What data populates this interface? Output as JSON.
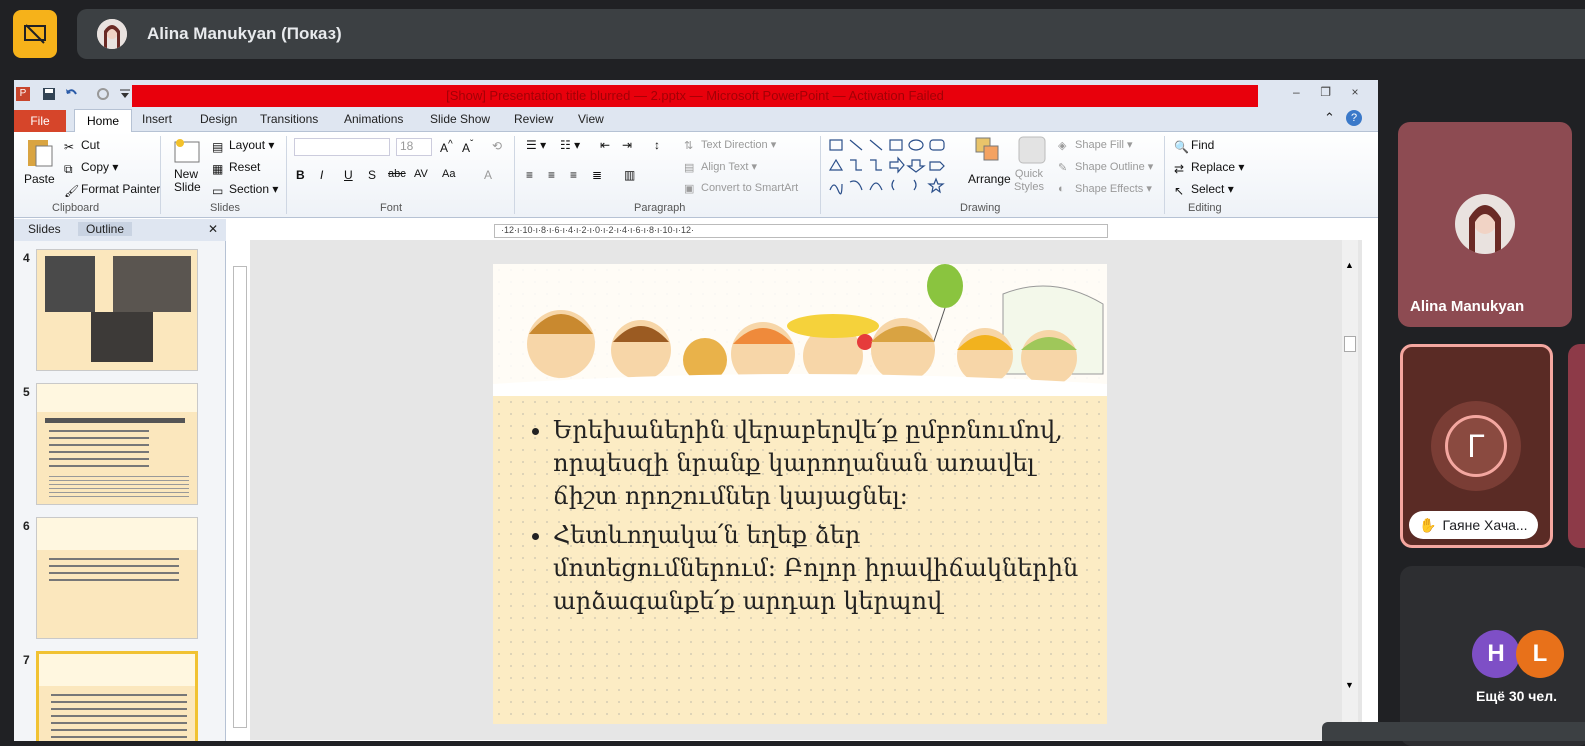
{
  "meet": {
    "presenter_label": "Alina Manukyan (Показ)",
    "colors": {
      "bg": "#202124",
      "pill": "#3c4043",
      "present_icon": "#f6b21a"
    }
  },
  "powerpoint": {
    "title_text": "[Show] Presentation title blurred — 2.pptx — Microsoft PowerPoint — Activation Failed",
    "window_controls": [
      "–",
      "❐",
      "×"
    ],
    "tabs": [
      "File",
      "Home",
      "Insert",
      "Design",
      "Transitions",
      "Animations",
      "Slide Show",
      "Review",
      "View"
    ],
    "ribbon": {
      "clipboard": {
        "label": "Clipboard",
        "paste": "Paste",
        "cut": "Cut",
        "copy": "Copy",
        "format_painter": "Format Painter"
      },
      "slides": {
        "label": "Slides",
        "new_slide_1": "New",
        "new_slide_2": "Slide",
        "layout": "Layout",
        "reset": "Reset",
        "section": "Section"
      },
      "font": {
        "label": "Font",
        "size": "18",
        "buttons": [
          "B",
          "I",
          "U",
          "S",
          "abc",
          "AV",
          "Aa",
          "A"
        ]
      },
      "paragraph": {
        "label": "Paragraph",
        "text_direction": "Text Direction",
        "align_text": "Align Text",
        "convert_smartart": "Convert to SmartArt"
      },
      "drawing": {
        "label": "Drawing",
        "arrange": "Arrange",
        "quick_styles_1": "Quick",
        "quick_styles_2": "Styles",
        "shape_fill": "Shape Fill",
        "shape_outline": "Shape Outline",
        "shape_effects": "Shape Effects"
      },
      "editing": {
        "label": "Editing",
        "find": "Find",
        "replace": "Replace",
        "select": "Select"
      }
    },
    "pane_tabs": [
      "Slides",
      "Outline"
    ],
    "thumbnails": [
      {
        "num": "4",
        "selected": false
      },
      {
        "num": "5",
        "selected": false
      },
      {
        "num": "6",
        "selected": false
      },
      {
        "num": "7",
        "selected": true
      }
    ],
    "hruler": "·12·ı·10·ı·8·ı·6·ı·4·ı·2·ı·0·ı·2·ı·4·ı·6·ı·8·ı·10·ı·12·",
    "slide": {
      "bullets": [
        "Երեխաներին վերաբերվե՛ք ըմբռնումով, որպեսզի նրանք կարողանան առավել ճիշտ որոշումներ կայացնել:",
        "Հետևողակա՛ն եղեք ձեր մոտեցումներում: Բոլոր իրավիճակներին արձագանքե՛ք արդար կերպով"
      ]
    }
  },
  "participants": {
    "tile1_name": "Alina Manukyan",
    "tile2_initial": "Г",
    "tile2_name": "Гаяне Хача...",
    "more_initials": [
      "H",
      "L"
    ],
    "more_label": "Ещё 30 чел.",
    "colors": {
      "tile1": "#8d4b52",
      "tile2": "#5a2b25",
      "h": "#7e4fc6",
      "l": "#e8711a"
    }
  }
}
